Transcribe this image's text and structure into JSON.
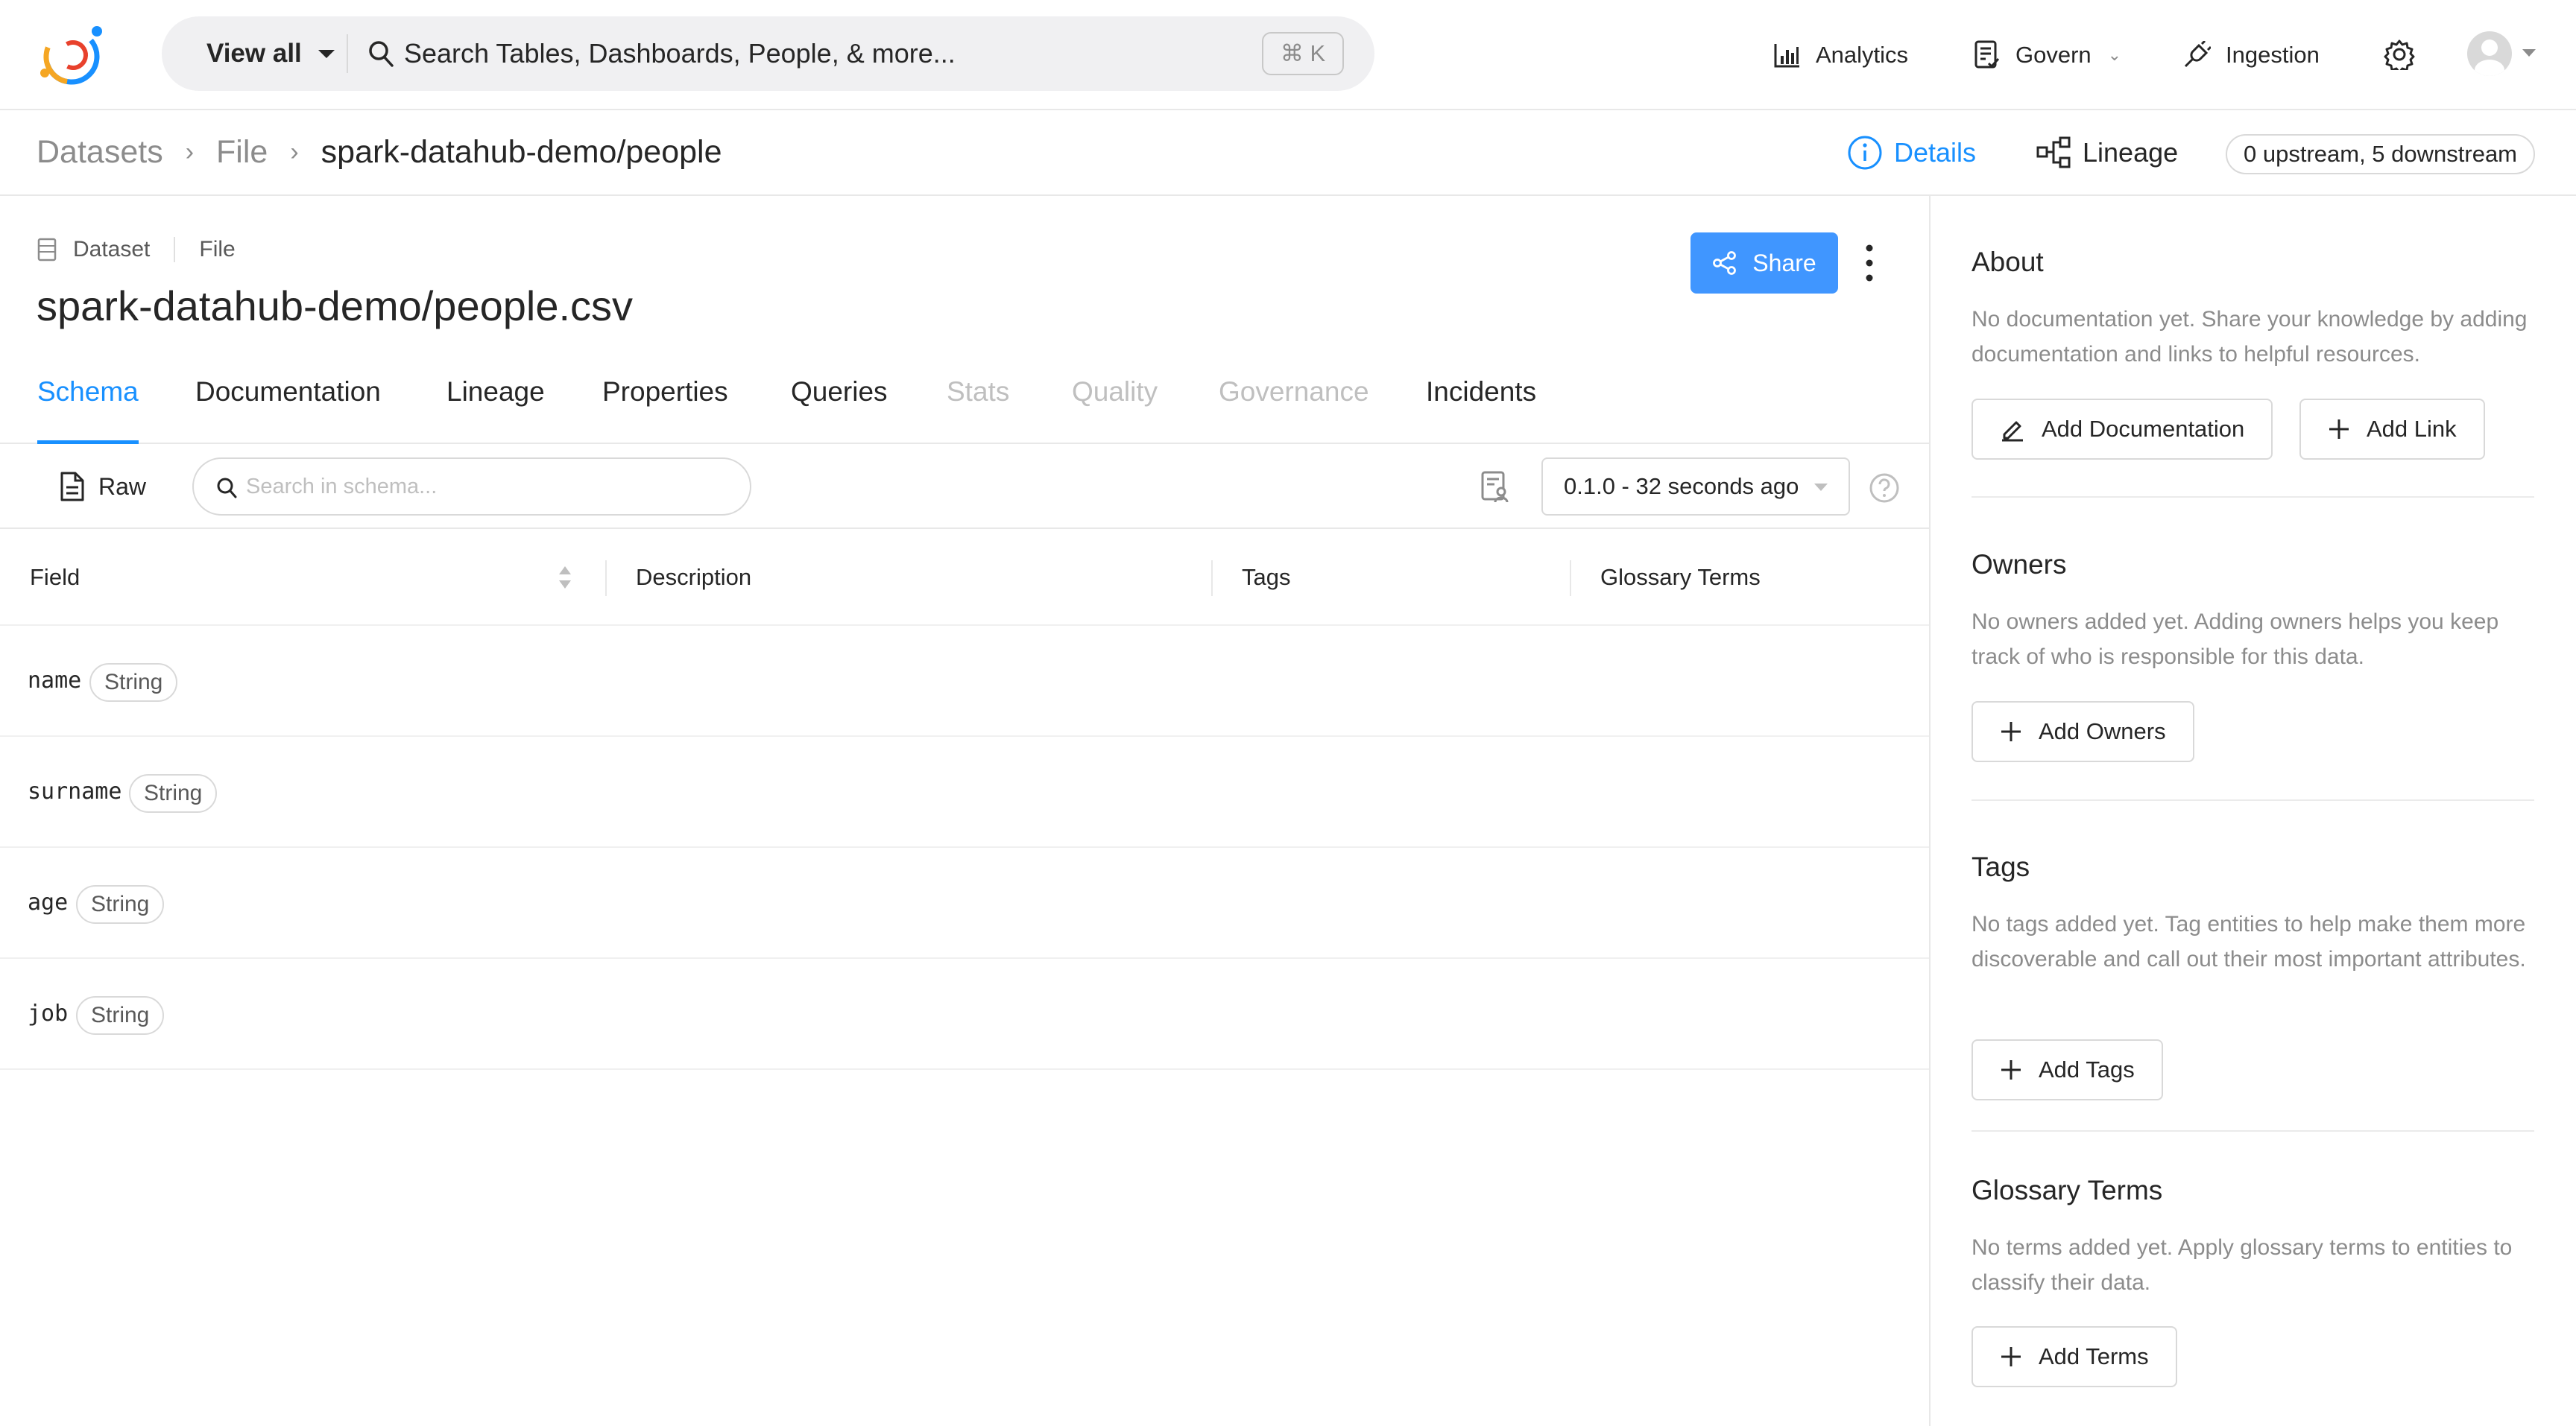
{
  "topnav": {
    "view_all_label": "View all",
    "search_placeholder": "Search Tables, Dashboards, People, & more...",
    "shortcut": "⌘ K",
    "items": {
      "analytics": "Analytics",
      "govern": "Govern",
      "ingestion": "Ingestion"
    },
    "brand_colors": [
      "#f5a623",
      "#1890ff",
      "#e8412c"
    ]
  },
  "breadcrumb": {
    "items": [
      "Datasets",
      "File",
      "spark-datahub-demo/people"
    ]
  },
  "view_tabs": {
    "details": "Details",
    "lineage": "Lineage",
    "lineage_counts": "0 upstream, 5 downstream"
  },
  "entity": {
    "type": "Dataset",
    "platform": "File",
    "title": "spark-datahub-demo/people.csv",
    "share_label": "Share"
  },
  "tabs": [
    {
      "label": "Schema",
      "state": "active"
    },
    {
      "label": "Documentation",
      "state": "normal"
    },
    {
      "label": "Lineage",
      "state": "normal"
    },
    {
      "label": "Properties",
      "state": "normal"
    },
    {
      "label": "Queries",
      "state": "normal"
    },
    {
      "label": "Stats",
      "state": "disabled"
    },
    {
      "label": "Quality",
      "state": "disabled"
    },
    {
      "label": "Governance",
      "state": "disabled"
    },
    {
      "label": "Incidents",
      "state": "normal"
    }
  ],
  "schema_toolbar": {
    "raw_label": "Raw",
    "search_placeholder": "Search in schema...",
    "version": "0.1.0 - 32 seconds ago"
  },
  "schema_table": {
    "columns": [
      "Field",
      "Description",
      "Tags",
      "Glossary Terms"
    ],
    "rows": [
      {
        "field": "name",
        "type": "String"
      },
      {
        "field": "surname",
        "type": "String"
      },
      {
        "field": "age",
        "type": "String"
      },
      {
        "field": "job",
        "type": "String"
      }
    ]
  },
  "sidebar": {
    "about": {
      "title": "About",
      "desc": "No documentation yet. Share your knowledge by adding documentation and links to helpful resources.",
      "add_doc": "Add Documentation",
      "add_link": "Add Link"
    },
    "owners": {
      "title": "Owners",
      "desc": "No owners added yet. Adding owners helps you keep track of who is responsible for this data.",
      "add": "Add Owners"
    },
    "tags": {
      "title": "Tags",
      "desc": "No tags added yet. Tag entities to help make them more discoverable and call out their most important attributes.",
      "add": "Add Tags"
    },
    "glossary": {
      "title": "Glossary Terms",
      "desc": "No terms added yet. Apply glossary terms to entities to classify their data.",
      "add": "Add Terms"
    }
  },
  "colors": {
    "accent": "#1890ff",
    "share_button": "#4096ff",
    "muted_text": "#8c8c8c"
  }
}
